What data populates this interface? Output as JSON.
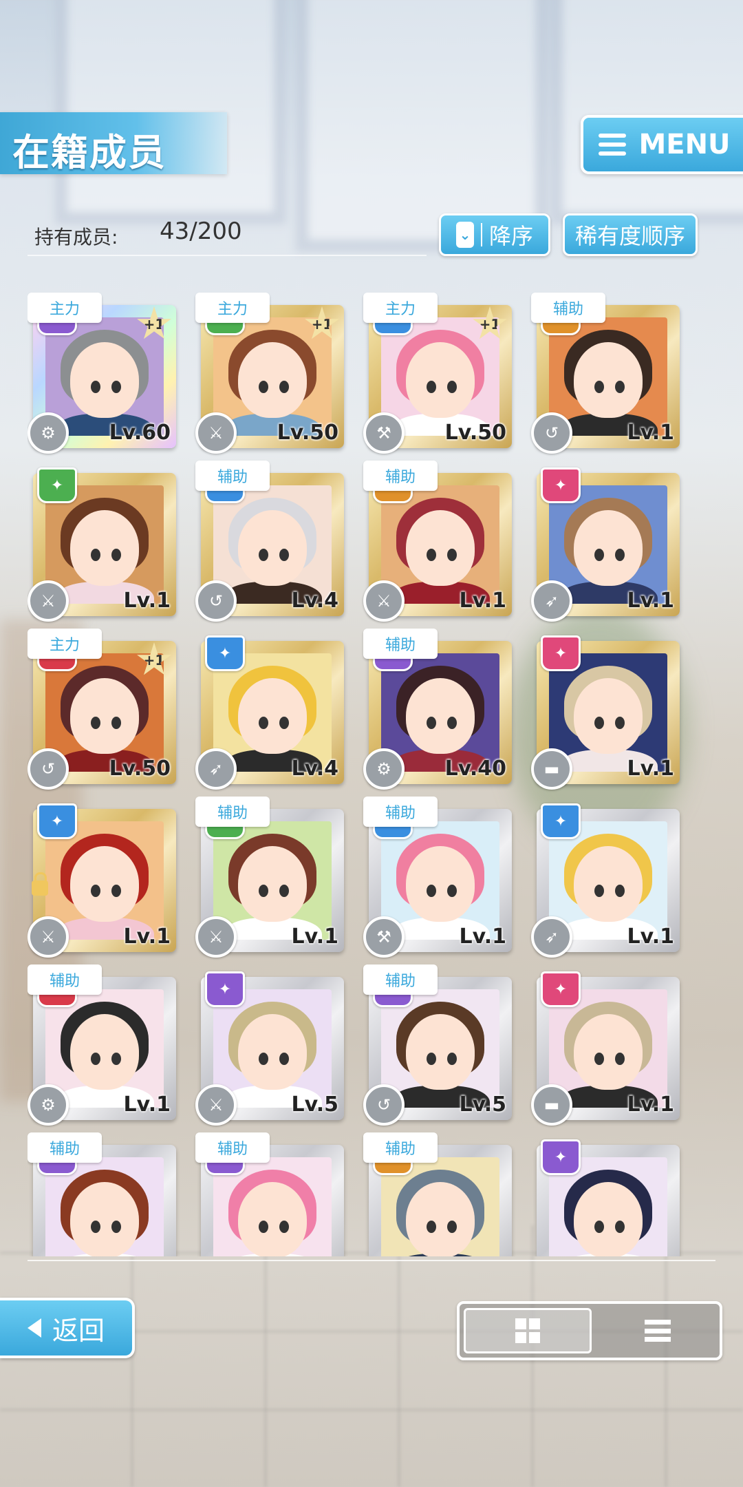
{
  "header": {
    "title": "在籍成员",
    "menu_label": "MENU"
  },
  "count": {
    "label": "持有成员:",
    "value": "43/200"
  },
  "sort": {
    "order_label": "降序",
    "rarity_label": "稀有度顺序"
  },
  "colors": {
    "accent": "#3aa8dc",
    "role_text": "#3aa8dc"
  },
  "members": [
    {
      "role": "主力",
      "plus": "+1",
      "level": "Lv.60",
      "frame": "rainbow",
      "attr": "purple",
      "hair": "#8c8f91",
      "bg": "#b9a0d8",
      "body": "#2b4d7a",
      "skill": "gear-icon",
      "locked": false
    },
    {
      "role": "主力",
      "plus": "+1",
      "level": "Lv.50",
      "frame": "gold",
      "attr": "green",
      "hair": "#8a4a2d",
      "bg": "#f3c38a",
      "body": "#7aa6c9",
      "skill": "sword-icon",
      "locked": false
    },
    {
      "role": "主力",
      "plus": "+1",
      "level": "Lv.50",
      "frame": "gold",
      "attr": "blue",
      "hair": "#f07fa2",
      "bg": "#f6d6e6",
      "body": "#ffffff",
      "skill": "hammer-icon",
      "locked": false
    },
    {
      "role": "辅助",
      "plus": "",
      "level": "Lv.1",
      "frame": "gold",
      "attr": "orange",
      "hair": "#3a2a22",
      "bg": "#e58a4e",
      "body": "#2b2b2b",
      "skill": "hook-icon",
      "locked": false
    },
    {
      "role": "",
      "plus": "",
      "level": "Lv.1",
      "frame": "gold",
      "attr": "green",
      "hair": "#6b3a22",
      "bg": "#d69a5e",
      "body": "#f2d9e1",
      "skill": "sword-icon",
      "locked": false
    },
    {
      "role": "辅助",
      "plus": "",
      "level": "Lv.4",
      "frame": "gold",
      "attr": "blue",
      "hair": "#d9d9de",
      "bg": "#f5e0d4",
      "body": "#3b2a22",
      "skill": "hook-icon",
      "locked": false
    },
    {
      "role": "辅助",
      "plus": "",
      "level": "Lv.1",
      "frame": "gold",
      "attr": "orange",
      "hair": "#9e2f3a",
      "bg": "#e7b07a",
      "body": "#9a1f2b",
      "skill": "sword-icon",
      "locked": false
    },
    {
      "role": "",
      "plus": "",
      "level": "Lv.1",
      "frame": "gold",
      "attr": "pink",
      "hair": "#a57a55",
      "bg": "#6f8ed0",
      "body": "#2e3a66",
      "skill": "rocket-icon",
      "locked": false
    },
    {
      "role": "主力",
      "plus": "+1",
      "level": "Lv.50",
      "frame": "gold",
      "attr": "red",
      "hair": "#5c2a2a",
      "bg": "#d9783a",
      "body": "#8a1f1f",
      "skill": "hook-icon",
      "locked": false
    },
    {
      "role": "",
      "plus": "",
      "level": "Lv.4",
      "frame": "gold",
      "attr": "blue",
      "hair": "#f0c33d",
      "bg": "#f3e2a0",
      "body": "#2b2b2b",
      "skill": "rocket-icon",
      "locked": false
    },
    {
      "role": "辅助",
      "plus": "",
      "level": "Lv.40",
      "frame": "gold",
      "attr": "purple",
      "hair": "#3b2226",
      "bg": "#5b4a9a",
      "body": "#9a2b3a",
      "skill": "gear-icon",
      "locked": false
    },
    {
      "role": "",
      "plus": "",
      "level": "Lv.1",
      "frame": "gold",
      "attr": "pink",
      "hair": "#d8c7a4",
      "bg": "#2d3a75",
      "body": "#f1e6e6",
      "skill": "roller-icon",
      "locked": false
    },
    {
      "role": "",
      "plus": "",
      "level": "Lv.1",
      "frame": "gold",
      "attr": "blue",
      "hair": "#b3261e",
      "bg": "#f3c18a",
      "body": "#f3c6d2",
      "skill": "sword-icon",
      "locked": true
    },
    {
      "role": "辅助",
      "plus": "",
      "level": "Lv.1",
      "frame": "silver",
      "attr": "green",
      "hair": "#7a3a2a",
      "bg": "#cfe6a6",
      "body": "#ffffff",
      "skill": "sword-icon",
      "locked": false
    },
    {
      "role": "辅助",
      "plus": "",
      "level": "Lv.1",
      "frame": "silver",
      "attr": "blue",
      "hair": "#f07fa0",
      "bg": "#d9eef8",
      "body": "#ffffff",
      "skill": "hammer-icon",
      "locked": false
    },
    {
      "role": "",
      "plus": "",
      "level": "Lv.1",
      "frame": "silver",
      "attr": "blue",
      "hair": "#f0c64a",
      "bg": "#dff0f8",
      "body": "#ffffff",
      "skill": "rocket-icon",
      "locked": false
    },
    {
      "role": "辅助",
      "plus": "",
      "level": "Lv.1",
      "frame": "silver",
      "attr": "red",
      "hair": "#2b2b2b",
      "bg": "#f7e2ea",
      "body": "#ffffff",
      "skill": "gear-icon",
      "locked": false
    },
    {
      "role": "",
      "plus": "",
      "level": "Lv.5",
      "frame": "silver",
      "attr": "purple",
      "hair": "#c9b98a",
      "bg": "#ecdff4",
      "body": "#ffffff",
      "skill": "sword-icon",
      "locked": false
    },
    {
      "role": "辅助",
      "plus": "",
      "level": "Lv.5",
      "frame": "silver",
      "attr": "purple",
      "hair": "#5a3a26",
      "bg": "#f1e6f2",
      "body": "#2b2b2b",
      "skill": "hook-icon",
      "locked": false
    },
    {
      "role": "",
      "plus": "",
      "level": "Lv.1",
      "frame": "silver",
      "attr": "pink",
      "hair": "#c8b896",
      "bg": "#f3dbe8",
      "body": "#2b2b2b",
      "skill": "roller-icon",
      "locked": false
    },
    {
      "role": "辅助",
      "plus": "",
      "level": "",
      "frame": "silver",
      "attr": "purple",
      "hair": "#8a3a22",
      "bg": "#efe0f4",
      "body": "#ffffff",
      "skill": "",
      "locked": false
    },
    {
      "role": "辅助",
      "plus": "",
      "level": "",
      "frame": "silver",
      "attr": "purple",
      "hair": "#f07fa8",
      "bg": "#f7e2ee",
      "body": "#ffffff",
      "skill": "",
      "locked": false
    },
    {
      "role": "辅助",
      "plus": "",
      "level": "",
      "frame": "silver",
      "attr": "orange",
      "hair": "#6d7f90",
      "bg": "#f1e4b6",
      "body": "#2b3a55",
      "skill": "",
      "locked": false
    },
    {
      "role": "",
      "plus": "",
      "level": "",
      "frame": "silver",
      "attr": "purple",
      "hair": "#262a4a",
      "bg": "#efe4f4",
      "body": "#ffffff",
      "skill": "",
      "locked": false
    }
  ],
  "footer": {
    "back_label": "返回",
    "view_grid": "grid-view-icon",
    "view_list": "list-view-icon"
  }
}
